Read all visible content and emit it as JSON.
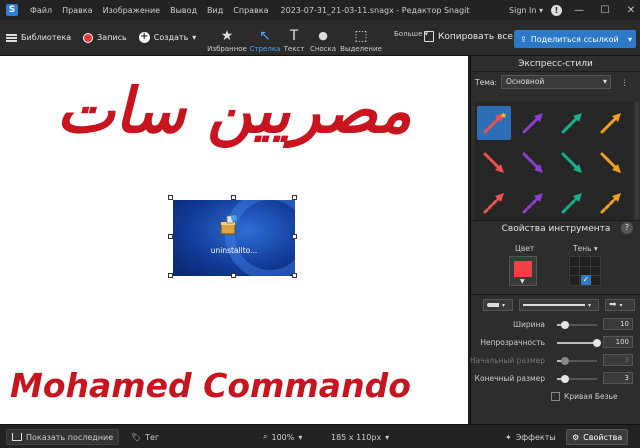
{
  "titlebar": {
    "menu": [
      "Файл",
      "Правка",
      "Изображение",
      "Вывод",
      "Вид",
      "Справка"
    ],
    "document_title": "2023-07-31_21-03-11.snagx - Редактор Snagit",
    "sign_in": "Sign In",
    "minimize": "—",
    "maximize": "☐",
    "close": "✕"
  },
  "toolbar": {
    "library": "Библиотека",
    "record": "Запись",
    "create": "Создать",
    "tools": [
      {
        "label": "Избранное",
        "icon": "★"
      },
      {
        "label": "Стрелка",
        "icon": "↖"
      },
      {
        "label": "Текст",
        "icon": "T"
      },
      {
        "label": "Сноска",
        "icon": "💬"
      },
      {
        "label": "Выделение",
        "icon": "⬚"
      }
    ],
    "more": "Больше",
    "copy_all": "Копировать все",
    "share": "Поделиться ссылкой"
  },
  "canvas": {
    "arabic_text": "مصريين سات",
    "english_text": "Mohamed Commando",
    "embedded_caption": "uninstallto..."
  },
  "panel": {
    "quick_styles": "Экспресс-стили",
    "theme_label": "Тема:",
    "theme_value": "Основной",
    "arrow_colors": [
      "#f05050",
      "#8a3fd0",
      "#16b08a",
      "#f0a020",
      "#f05050",
      "#8a3fd0",
      "#16b08a",
      "#f0a020",
      "#f05050",
      "#8a3fd0",
      "#16b08a",
      "#f0a020"
    ],
    "tool_properties": "Свойства инструмента",
    "help": "?",
    "color_label": "Цвет",
    "shadow_label": "Тень",
    "color_value": "#f04040",
    "sliders": [
      {
        "name": "Ширина",
        "value": "10",
        "level": 0.2,
        "disabled": false
      },
      {
        "name": "Непрозрачность",
        "value": "100",
        "level": 1.0,
        "disabled": false
      },
      {
        "name": "Начальный размер",
        "value": "3",
        "level": 0.2,
        "disabled": true
      },
      {
        "name": "Конечный размер",
        "value": "3",
        "level": 0.2,
        "disabled": false
      }
    ],
    "bezier": "Кривая Безье"
  },
  "statusbar": {
    "show_recent": "Показать последние",
    "tag": "Тег",
    "zoom": "100%",
    "size": "185 x 110px",
    "effects": "Эффекты",
    "properties": "Свойства"
  }
}
